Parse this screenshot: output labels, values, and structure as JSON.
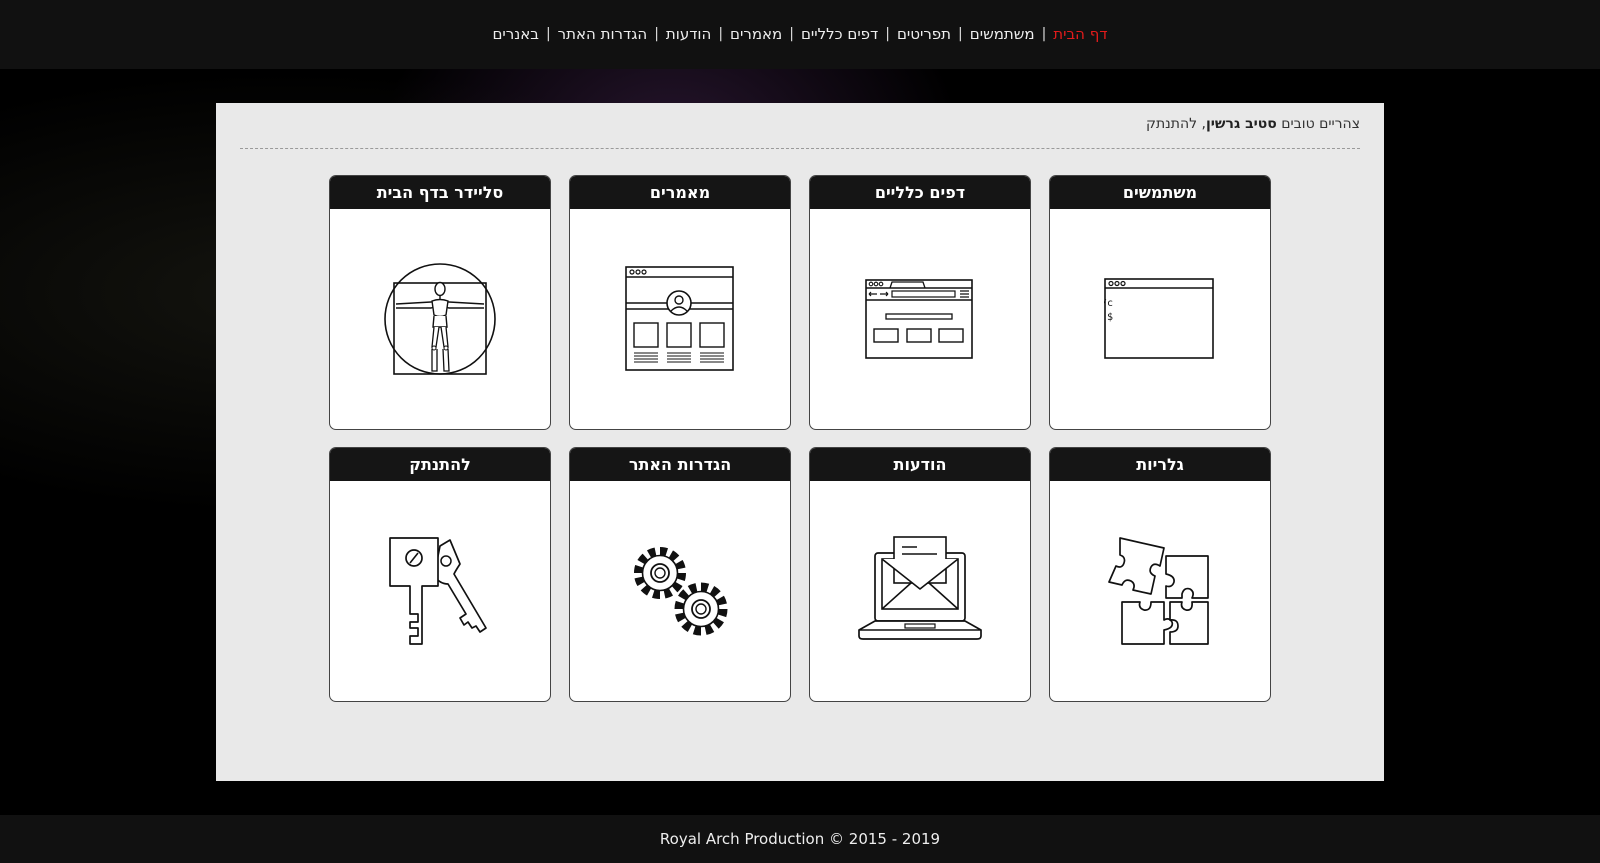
{
  "nav": {
    "items": [
      {
        "label": "דף הבית",
        "active": true
      },
      {
        "label": "משתמשים"
      },
      {
        "label": "תפריטים"
      },
      {
        "label": "דפים כלליים"
      },
      {
        "label": "מאמרים"
      },
      {
        "label": "הודעות"
      },
      {
        "label": "הגדרות האתר"
      },
      {
        "label": "באנרים"
      }
    ],
    "separator": "|",
    "active_color": "#e21b1b"
  },
  "greeting": {
    "prefix": "צהריים טובים",
    "user_name": "סטיב גרשין",
    "comma": ",",
    "logout_label": "להתנתק"
  },
  "tiles": [
    {
      "title": "משתמשים",
      "icon": "terminal-window-icon",
      "terminal_line1": "user@user /c",
      "terminal_line2": "$ _"
    },
    {
      "title": "דפים כלליים",
      "icon": "browser-window-icon"
    },
    {
      "title": "מאמרים",
      "icon": "article-page-icon"
    },
    {
      "title": "סליידר בדף הבית",
      "icon": "vitruvian-man-icon"
    },
    {
      "title": "גלריות",
      "icon": "puzzle-icon"
    },
    {
      "title": "הודעות",
      "icon": "laptop-mail-icon"
    },
    {
      "title": "הגדרות האתר",
      "icon": "gears-icon"
    },
    {
      "title": "להתנתק",
      "icon": "keys-icon"
    }
  ],
  "footer": {
    "text": "Royal Arch Production © 2015 - 2019"
  }
}
